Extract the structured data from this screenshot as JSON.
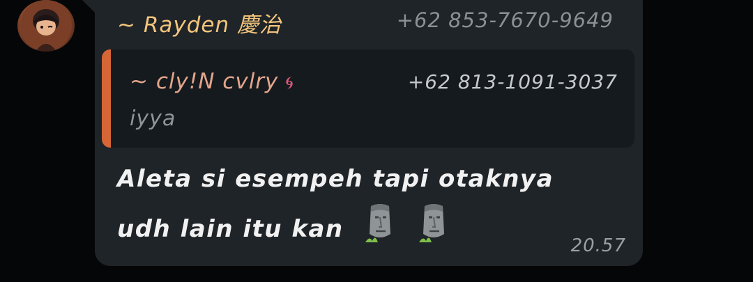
{
  "sender": {
    "name": "~ Rayden 慶治",
    "phone": "+62 853-7670-9649"
  },
  "quoted": {
    "name": "~ cly!N cvlry",
    "icon": "spiral-icon",
    "phone": "+62 813-1091-3037",
    "text": "iyya"
  },
  "message": {
    "line1": "Aleta si esempeh tapi otaknya",
    "line2": "udh lain itu kan",
    "emojis": [
      "moai-emoji",
      "moai-emoji"
    ]
  },
  "timestamp": "20.57",
  "colors": {
    "background": "#050608",
    "bubble": "#1f2428",
    "quote_background": "#151a1e",
    "quote_bar": "#d76637",
    "sender_name": "#f3c57c",
    "quoted_name": "#e3a58c"
  }
}
